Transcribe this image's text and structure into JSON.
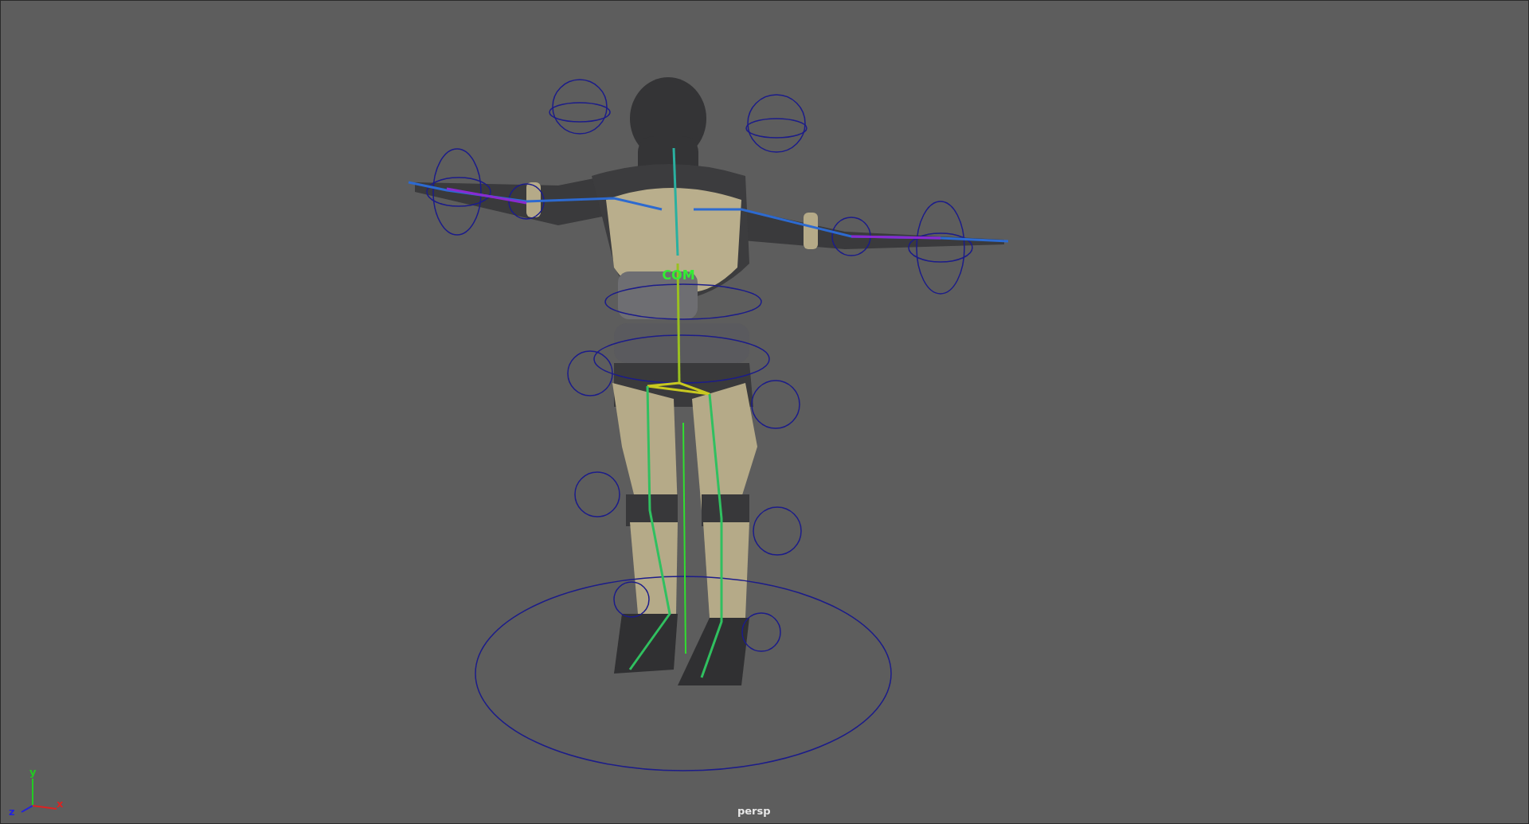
{
  "viewport": {
    "rig_label": "COM",
    "camera_label": "persp",
    "axes": [
      {
        "label": "y",
        "color": "#22cc22"
      },
      {
        "label": "z",
        "color": "#2222dd"
      },
      {
        "label": "x",
        "color": "#dd2222"
      }
    ]
  }
}
